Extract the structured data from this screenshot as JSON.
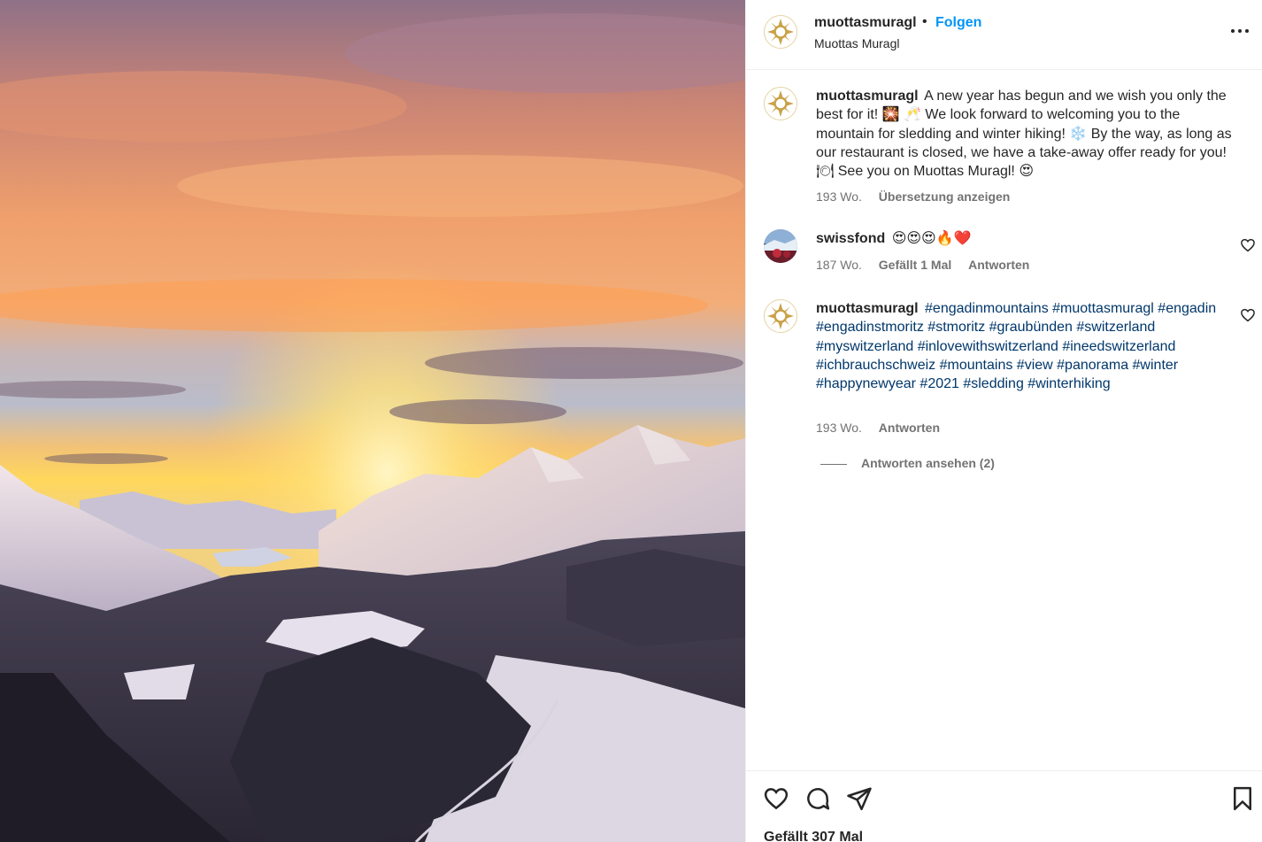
{
  "header": {
    "username": "muottasmuragl",
    "separator": "•",
    "follow_label": "Folgen",
    "location": "Muottas Muragl"
  },
  "caption": {
    "username": "muottasmuragl",
    "text": "A new year has begun and we wish you only the best for it! 🎇 🥂 We look forward to welcoming you to the mountain for sledding and winter hiking! ❄️ By the way, as long as our restaurant is closed, we have a take-away offer ready for you! 🍽 See you on Muottas Muragl! 😍",
    "age": "193 Wo.",
    "translate_label": "Übersetzung anzeigen"
  },
  "comments": [
    {
      "username": "swissfond",
      "text": "😍😍😍🔥❤️",
      "age": "187 Wo.",
      "likes": "Gefällt 1 Mal",
      "reply_label": "Antworten"
    },
    {
      "username": "muottasmuragl",
      "text": "#engadinmountains #muottasmuragl #engadin #engadinstmoritz #stmoritz #graubünden #switzerland #myswitzerland #inlovewithswitzerland #ineedswitzerland #ichbrauchschweiz #mountains #view #panorama #winter #happynewyear #2021 #sledding #winterhiking",
      "age": "193 Wo.",
      "reply_label": "Antworten",
      "view_replies_label": "Antworten ansehen (2)"
    }
  ],
  "footer": {
    "likes_label": "Gefällt 307 Mal"
  },
  "icons": {
    "more": "more-options-icon",
    "like": "heart-icon",
    "comment": "comment-icon",
    "share": "share-icon",
    "save": "bookmark-icon"
  },
  "colors": {
    "accent": "#0095f6",
    "hashtag": "#00376b",
    "muted": "#737373",
    "brand_gold": "#c9a24a"
  }
}
